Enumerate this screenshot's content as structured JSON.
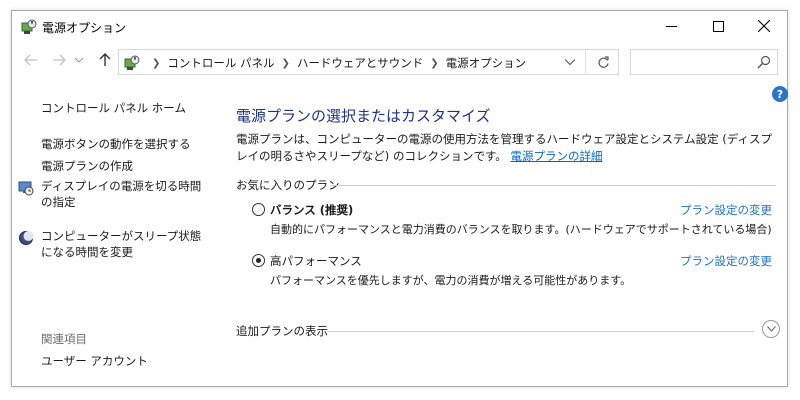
{
  "window": {
    "title": "電源オプション",
    "accent": "#1e3287",
    "link_color": "#0066cc"
  },
  "titlebar_icons": {
    "app": "power-options-icon",
    "minimize": "minimize-icon",
    "maximize": "maximize-icon",
    "close": "close-icon"
  },
  "address": {
    "breadcrumbs": [
      "コントロール パネル",
      "ハードウェアとサウンド",
      "電源オプション"
    ],
    "search_placeholder": ""
  },
  "sidebar": {
    "home": "コントロール パネル ホーム",
    "links": [
      {
        "label": "電源ボタンの動作を選択する",
        "icon": ""
      },
      {
        "label": "電源プランの作成",
        "icon": ""
      },
      {
        "label": "ディスプレイの電源を切る時間の指定",
        "icon": "display-clock-icon"
      },
      {
        "label": "コンピューターがスリープ状態になる時間を変更",
        "icon": "moon-icon"
      }
    ],
    "related_heading": "関連項目",
    "related_links": [
      "ユーザー アカウント"
    ]
  },
  "main": {
    "title": "電源プランの選択またはカスタマイズ",
    "description": "電源プランは、コンピューターの電源の使用方法を管理するハードウェア設定とシステム設定 (ディスプレイの明るさやスリープなど) のコレクションです。",
    "detail_link": "電源プランの詳細",
    "favorites_label": "お気に入りのプラン",
    "plans": [
      {
        "name": "バランス (推奨)",
        "description": "自動的にパフォーマンスと電力消費のバランスを取ります。(ハードウェアでサポートされている場合)",
        "settings_link": "プラン設定の変更",
        "selected": false
      },
      {
        "name": "高パフォーマンス",
        "description": "パフォーマンスを優先しますが、電力の消費が増える可能性があります。",
        "settings_link": "プラン設定の変更",
        "selected": true
      }
    ],
    "more_plans": "追加プランの表示"
  }
}
